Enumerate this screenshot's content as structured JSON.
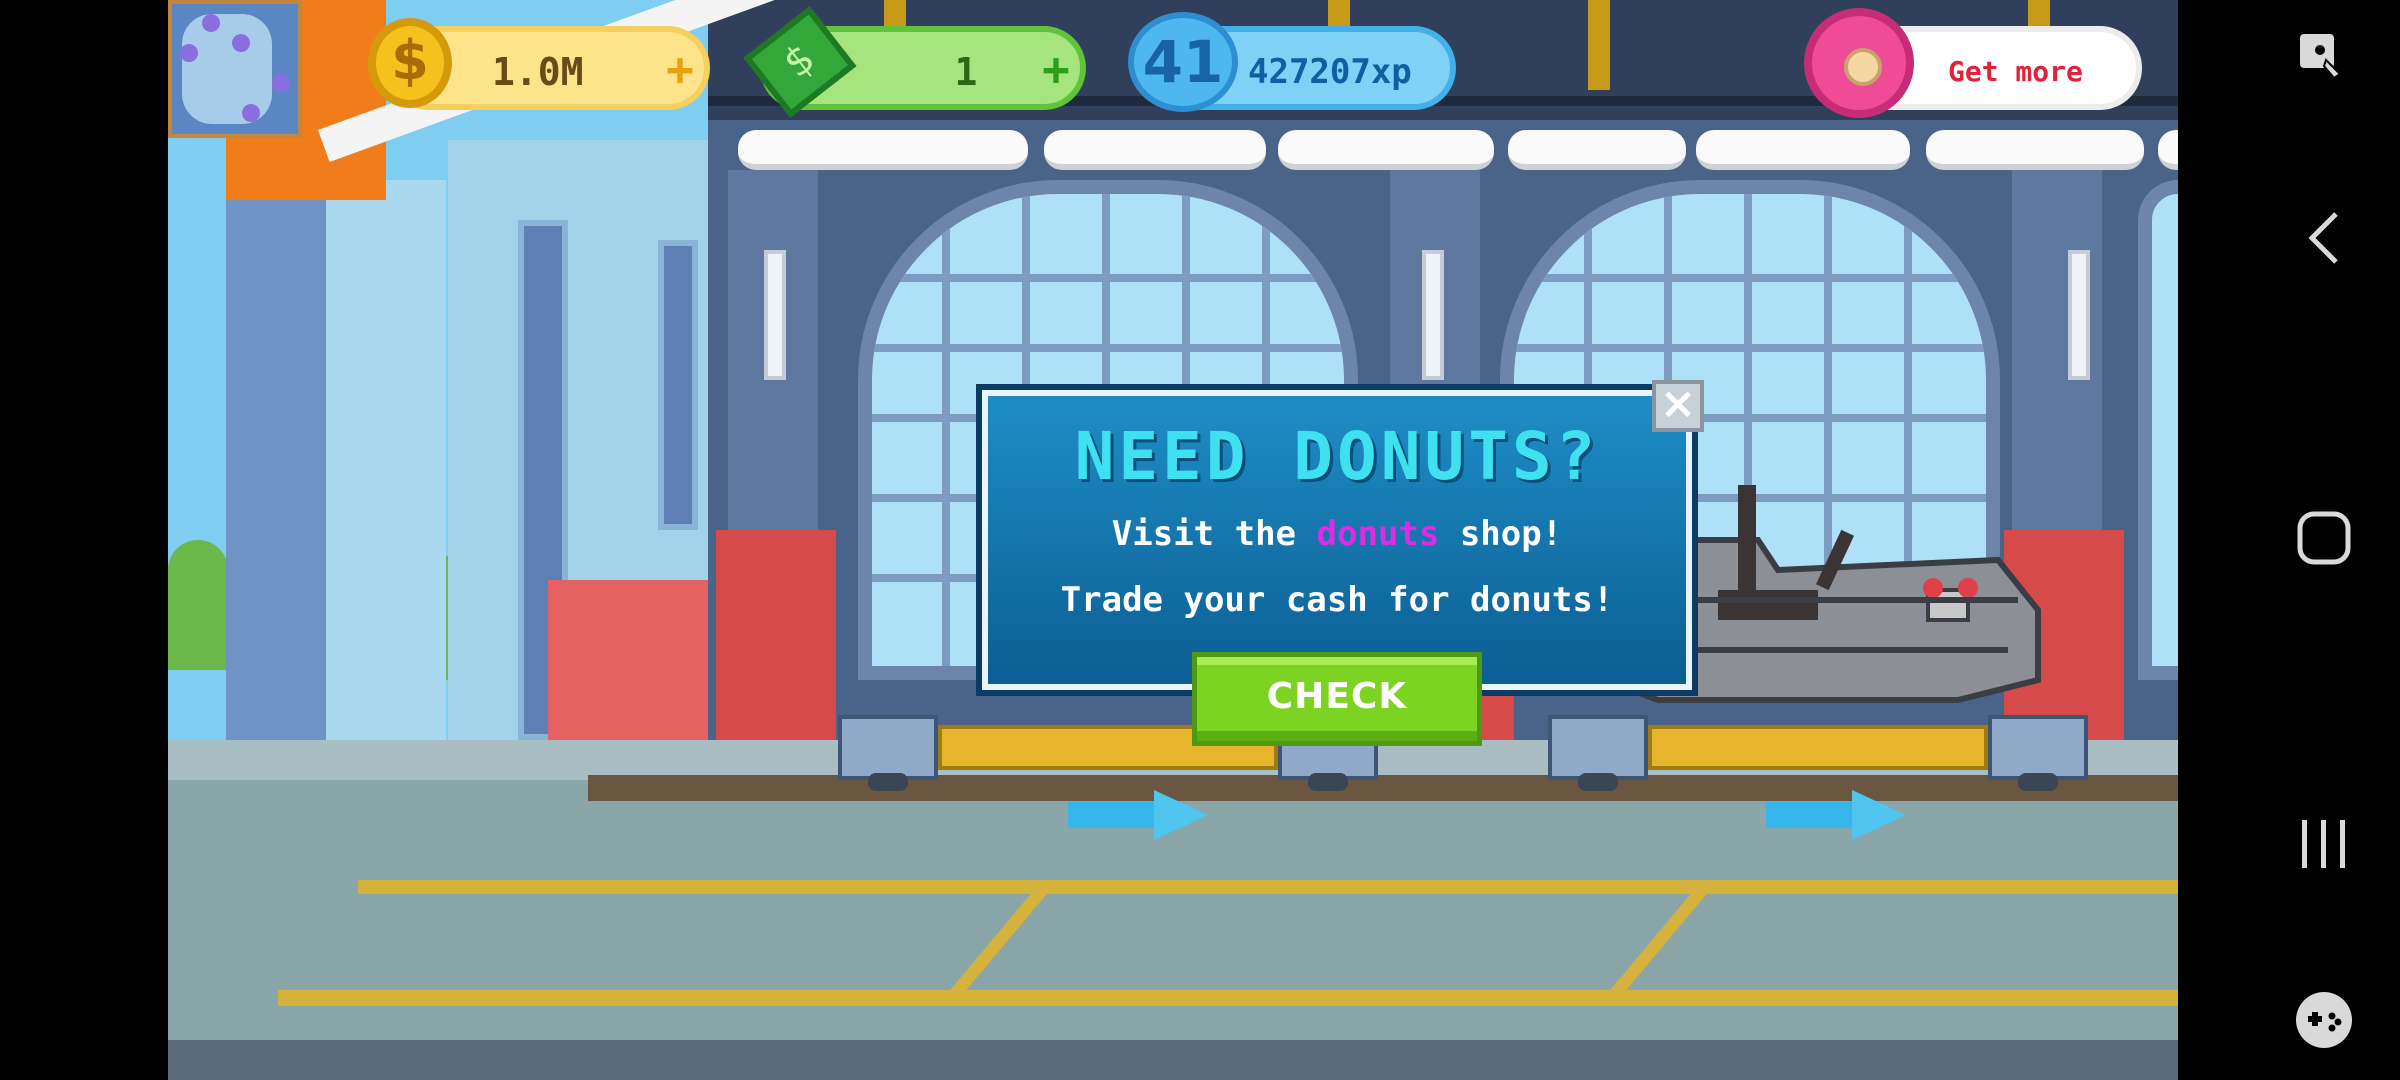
{
  "hud": {
    "coins": "1.0M",
    "cash": "1",
    "level": "41",
    "xp": "427207xp",
    "donut_button": "Get more",
    "coin_symbol": "$",
    "plus": "+"
  },
  "dialog": {
    "title": "NEED DONUTS?",
    "line1_prefix": "Visit the",
    "line1_highlight": "donuts",
    "line1_suffix": "shop!",
    "line2": "Trade your cash for donuts!",
    "check_label": "CHECK",
    "close_glyph": "×"
  },
  "android_nav": {
    "accessibility_icon": "accessibility-icon",
    "back_icon": "back-icon",
    "home_icon": "home-icon",
    "recents_icon": "recents-icon",
    "game_tools_icon": "gamepad-icon"
  },
  "colors": {
    "dialog_title": "#3fe0ef",
    "highlight": "#e02ae6",
    "check_button": "#7dd321"
  }
}
